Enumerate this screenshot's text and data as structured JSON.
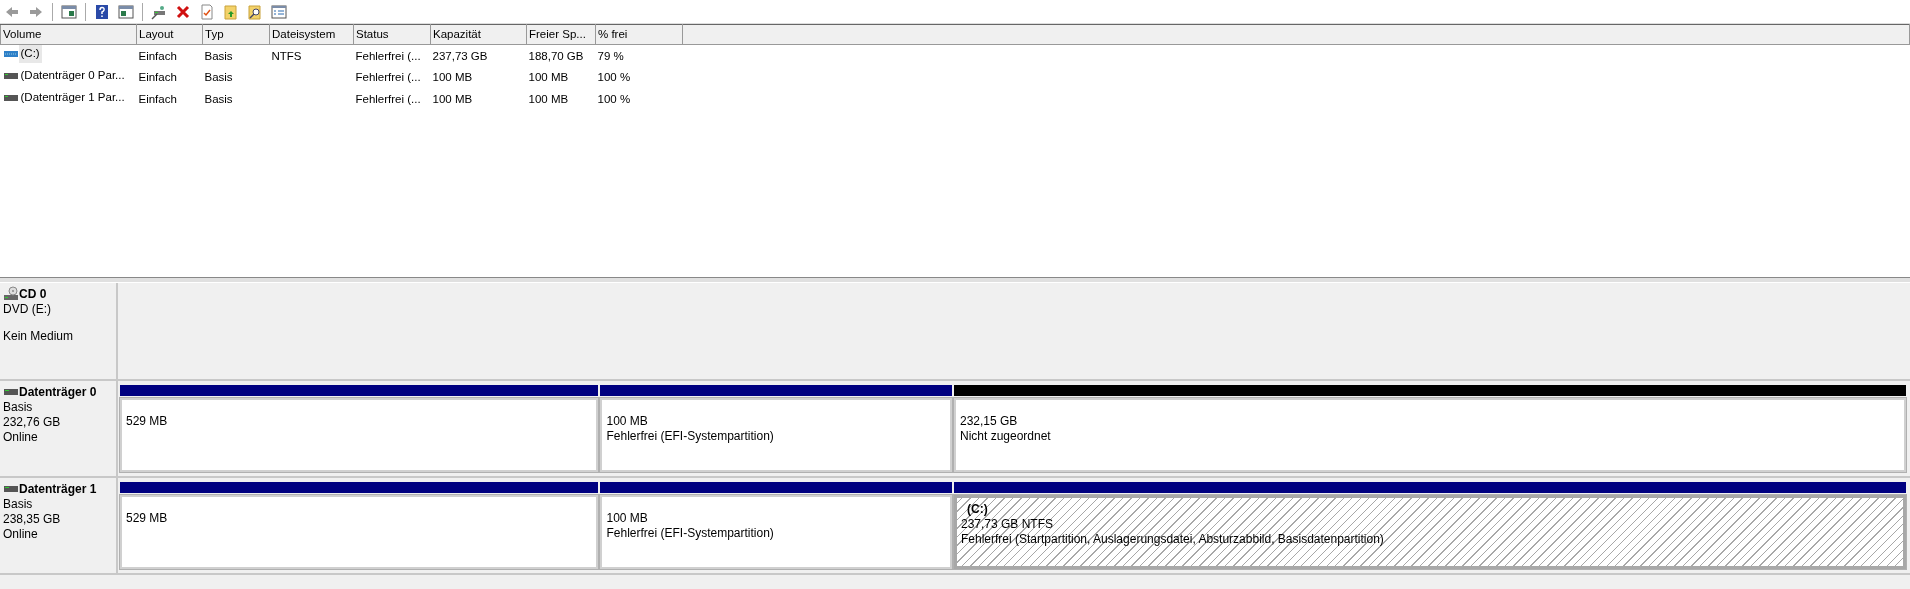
{
  "toolbar": [
    {
      "kind": "back"
    },
    {
      "kind": "forward"
    },
    {
      "kind": "separator"
    },
    {
      "kind": "console"
    },
    {
      "kind": "separator"
    },
    {
      "kind": "help"
    },
    {
      "kind": "panel"
    },
    {
      "kind": "separator"
    },
    {
      "kind": "connect"
    },
    {
      "kind": "delete"
    },
    {
      "kind": "check"
    },
    {
      "kind": "folder-up"
    },
    {
      "kind": "folder-search"
    },
    {
      "kind": "properties"
    }
  ],
  "volume_table": {
    "columns": [
      "Volume",
      "Layout",
      "Typ",
      "Dateisystem",
      "Status",
      "Kapazität",
      "Freier Sp...",
      "% frei"
    ],
    "rows": [
      {
        "kind": "volume",
        "selected": true,
        "cells": [
          "(C:)",
          "Einfach",
          "Basis",
          "NTFS",
          "Fehlerfrei (...",
          "237,73 GB",
          "188,70 GB",
          "79 %"
        ]
      },
      {
        "kind": "partition",
        "selected": false,
        "cells": [
          "(Datenträger 0 Par...",
          "Einfach",
          "Basis",
          "",
          "Fehlerfrei (...",
          "100 MB",
          "100 MB",
          "100 %"
        ]
      },
      {
        "kind": "partition",
        "selected": false,
        "cells": [
          "(Datenträger 1 Par...",
          "Einfach",
          "Basis",
          "",
          "Fehlerfrei (...",
          "100 MB",
          "100 MB",
          "100 %"
        ]
      }
    ]
  },
  "disks": [
    {
      "kind": "cdrom",
      "name": "CD 0",
      "type": "DVD (E:)",
      "status": "Kein Medium"
    },
    {
      "kind": "disk",
      "name": "Datenträger 0",
      "type": "Basis",
      "size": "232,76 GB",
      "status": "Online",
      "partitions": [
        {
          "kind": "primary",
          "selected": false,
          "size": "529 MB"
        },
        {
          "kind": "primary",
          "selected": false,
          "size": "100 MB",
          "status": "Fehlerfrei (EFI-Systempartition)"
        },
        {
          "kind": "unallocated",
          "selected": false,
          "size": "232,15 GB",
          "status": "Nicht zugeordnet"
        }
      ]
    },
    {
      "kind": "disk",
      "name": "Datenträger 1",
      "type": "Basis",
      "size": "238,35 GB",
      "status": "Online",
      "partitions": [
        {
          "kind": "primary",
          "selected": false,
          "size": "529 MB"
        },
        {
          "kind": "primary",
          "selected": false,
          "size": "100 MB",
          "status": "Fehlerfrei (EFI-Systempartition)"
        },
        {
          "kind": "primary",
          "selected": true,
          "label": "(C:)",
          "size": "237,73 GB NTFS",
          "status": "Fehlerfrei (Startpartition, Auslagerungsdatei, Absturzabbild, Basisdatenpartition)"
        }
      ]
    }
  ]
}
